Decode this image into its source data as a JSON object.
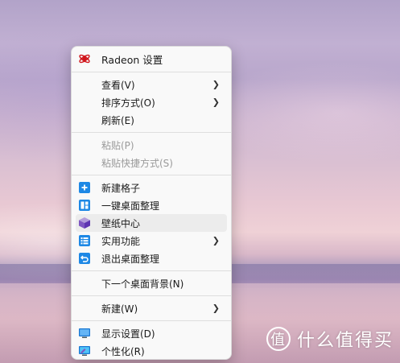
{
  "menu": {
    "items": [
      {
        "label": "Radeon 设置",
        "icon": "radeon-icon",
        "color": "#d0151b"
      },
      {
        "label": "查看(V)",
        "submenu": true
      },
      {
        "label": "排序方式(O)",
        "submenu": true
      },
      {
        "label": "刷新(E)"
      },
      {
        "label": "粘贴(P)",
        "disabled": true
      },
      {
        "label": "粘贴快捷方式(S)",
        "disabled": true
      },
      {
        "label": "新建格子",
        "icon": "plus-square-icon",
        "color": "#1e88e5"
      },
      {
        "label": "一键桌面整理",
        "icon": "layout-icon",
        "color": "#1e88e5"
      },
      {
        "label": "壁纸中心",
        "icon": "cube-icon",
        "color": "#7e57c2",
        "hovered": true
      },
      {
        "label": "实用功能",
        "icon": "list-icon",
        "color": "#1e88e5",
        "submenu": true
      },
      {
        "label": "退出桌面整理",
        "icon": "exit-icon",
        "color": "#1e88e5"
      },
      {
        "label": "下一个桌面背景(N)"
      },
      {
        "label": "新建(W)",
        "submenu": true
      },
      {
        "label": "显示设置(D)",
        "icon": "monitor-icon"
      },
      {
        "label": "个性化(R)",
        "icon": "personalize-icon"
      }
    ]
  },
  "watermark": {
    "logo_text": "值",
    "text": "什么值得买"
  }
}
